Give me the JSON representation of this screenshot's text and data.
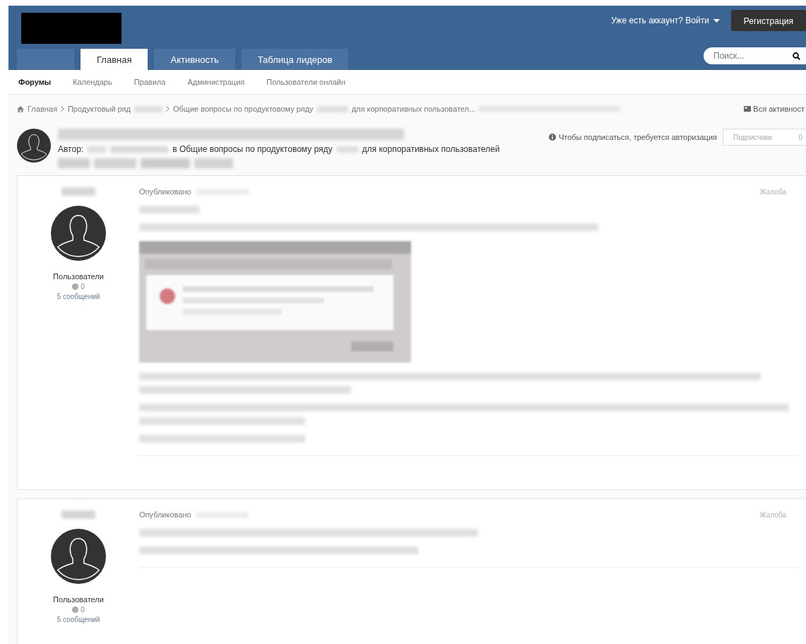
{
  "header": {
    "sign_in": "Уже есть аккаунт? Войти",
    "register": "Регистрация",
    "search": {
      "placeholder": "Поиск..."
    },
    "tabs": [
      {
        "label": "Главная",
        "selected": true
      },
      {
        "label": "Активность",
        "selected": false
      },
      {
        "label": "Таблица лидеров",
        "selected": false
      }
    ]
  },
  "subnav": [
    {
      "label": "Форумы",
      "selected": true
    },
    {
      "label": "Календарь",
      "selected": false
    },
    {
      "label": "Правила",
      "selected": false
    },
    {
      "label": "Администрация",
      "selected": false
    },
    {
      "label": "Пользователи онлайн",
      "selected": false
    }
  ],
  "breadcrumb": {
    "items": [
      {
        "parts": [
          "Главная"
        ]
      },
      {
        "parts": [
          "Продуктовый ряд"
        ]
      },
      {
        "parts": [
          "Общие вопросы по продуктовому ряду",
          "для корпоративных пользовател..."
        ]
      }
    ],
    "activity": "Вся активност"
  },
  "topic": {
    "author_label": "Автор:",
    "forum_parts": [
      "в Общие вопросы по продуктовому ряду",
      "для корпоративных пользователей"
    ],
    "follow_note": "Чтобы подписаться, требуется авторизация",
    "followers_label": "Подписчики",
    "followers_count": "0"
  },
  "posts": [
    {
      "group": "Пользователи",
      "reputation": "0",
      "posts_count": "5 сообщений",
      "published": "Опубликовано",
      "report": "Жалоба",
      "content": [
        {
          "kind": "line"
        },
        {
          "kind": "line"
        },
        {
          "kind": "picture"
        },
        {
          "kind": "paragraph"
        },
        {
          "kind": "paragraph"
        },
        {
          "kind": "line"
        }
      ]
    },
    {
      "group": "Пользователи",
      "reputation": "0",
      "posts_count": "5 сообщений",
      "published": "Опубликовано",
      "report": "Жалоба",
      "content": [
        {
          "kind": "line"
        },
        {
          "kind": "line"
        }
      ]
    }
  ]
}
